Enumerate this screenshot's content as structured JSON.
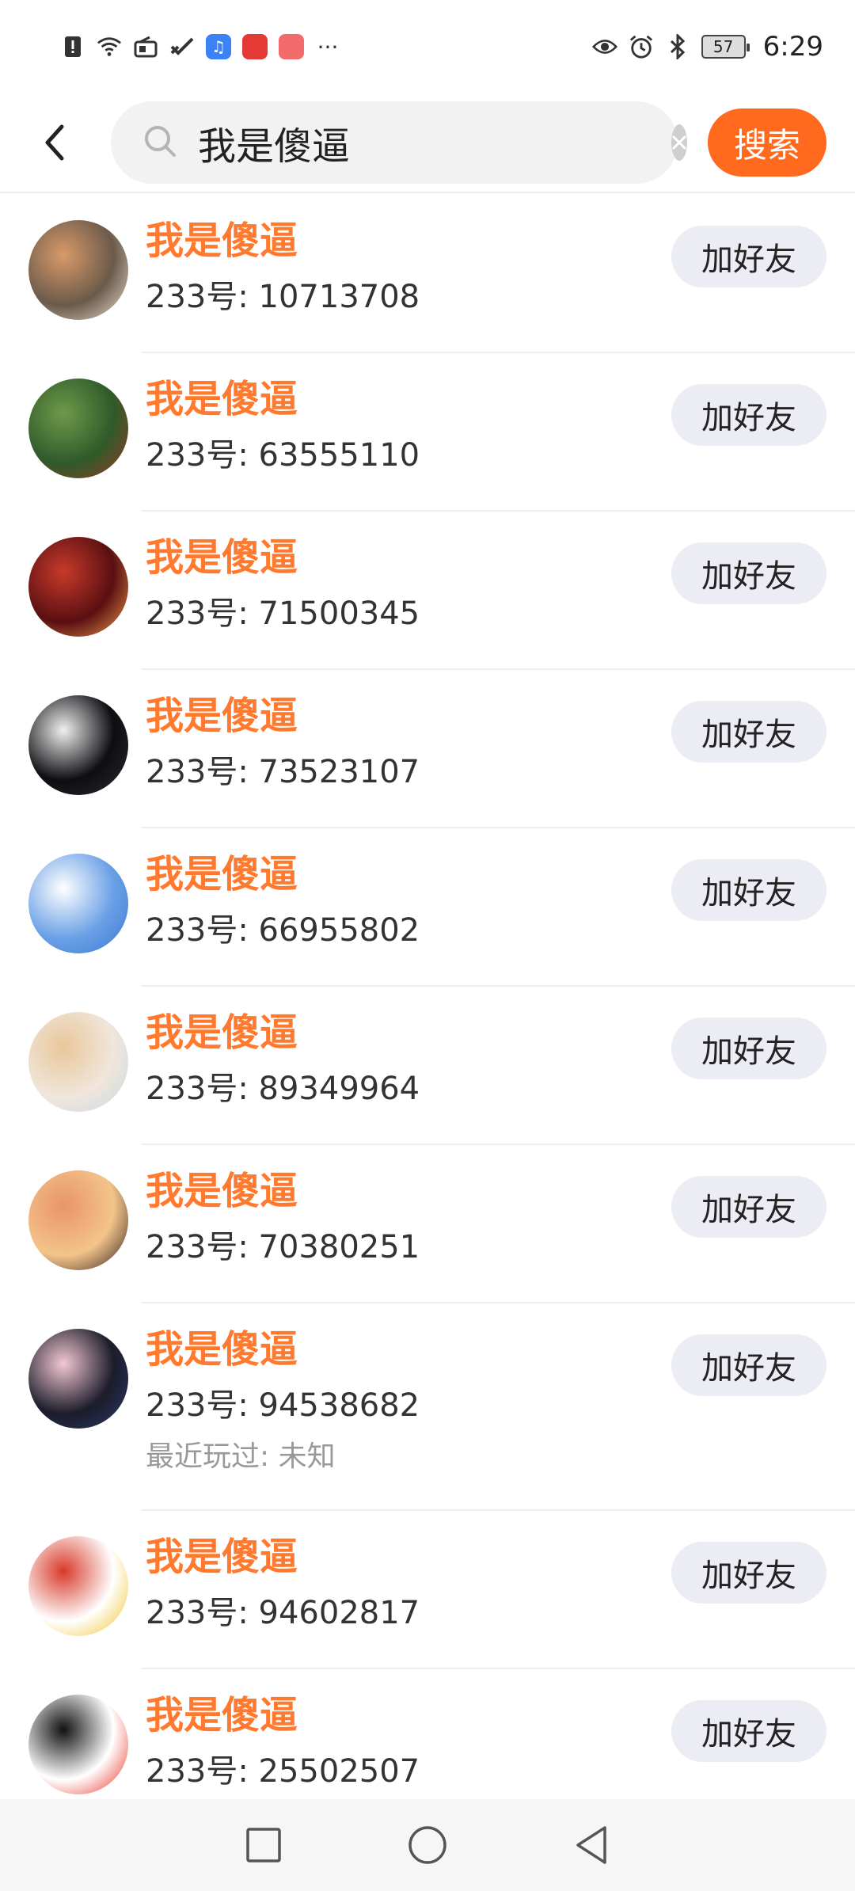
{
  "status_bar": {
    "time": "6:29",
    "battery": "57",
    "dots": "···"
  },
  "header": {
    "search_value": "我是傻逼",
    "search_button_label": "搜索"
  },
  "colors": {
    "accent": "#ff6a1f",
    "nickname": "#ff7a2f",
    "add_button_bg": "#ecedf4"
  },
  "results": [
    {
      "nickname": "我是傻逼",
      "uid": "233号: 10713708",
      "add_label": "加好友",
      "avatar_colors": [
        "#6b5a4a",
        "#d89a6a",
        "#efe4d8"
      ]
    },
    {
      "nickname": "我是傻逼",
      "uid": "233号: 63555110",
      "add_label": "加好友",
      "avatar_colors": [
        "#2f5a2a",
        "#6f9a4a",
        "#9c3a2a"
      ]
    },
    {
      "nickname": "我是傻逼",
      "uid": "233号: 71500345",
      "add_label": "加好友",
      "avatar_colors": [
        "#5a0f12",
        "#c73a2a",
        "#f2a04a"
      ]
    },
    {
      "nickname": "我是傻逼",
      "uid": "233号: 73523107",
      "add_label": "加好友",
      "avatar_colors": [
        "#0e0e12",
        "#f0f0f0",
        "#2a2a30"
      ]
    },
    {
      "nickname": "我是傻逼",
      "uid": "233号: 66955802",
      "add_label": "加好友",
      "avatar_colors": [
        "#6aa0e6",
        "#ffffff",
        "#3a78d0"
      ]
    },
    {
      "nickname": "我是傻逼",
      "uid": "233号: 89349964",
      "add_label": "加好友",
      "avatar_colors": [
        "#f0e6dc",
        "#e9c79a",
        "#c9d8e0"
      ]
    },
    {
      "nickname": "我是傻逼",
      "uid": "233号: 70380251",
      "add_label": "加好友",
      "avatar_colors": [
        "#f3c48a",
        "#e9946a",
        "#2a1a18"
      ]
    },
    {
      "nickname": "我是傻逼",
      "uid": "233号: 94538682",
      "add_label": "加好友",
      "recent": "最近玩过: 未知",
      "avatar_colors": [
        "#1c1c2a",
        "#f3c8d2",
        "#2a3a6a"
      ]
    },
    {
      "nickname": "我是傻逼",
      "uid": "233号: 94602817",
      "add_label": "加好友",
      "avatar_colors": [
        "#ffffff",
        "#d83a2a",
        "#f0c020"
      ]
    },
    {
      "nickname": "我是傻逼",
      "uid": "233号: 25502507",
      "add_label": "加好友",
      "avatar_colors": [
        "#ffffff",
        "#111111",
        "#e8261a"
      ]
    }
  ]
}
